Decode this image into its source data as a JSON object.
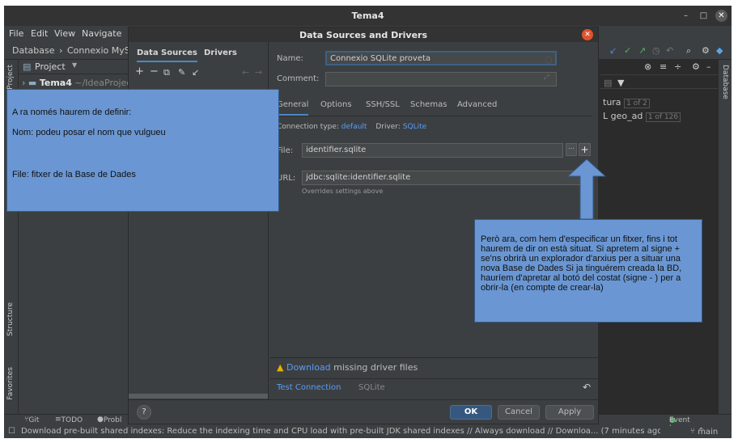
{
  "window": {
    "title": "Tema4"
  },
  "menu": [
    "File",
    "Edit",
    "View",
    "Navigate"
  ],
  "breadcrumb": [
    "Database",
    "Connexio MySQL"
  ],
  "project": {
    "header": "Project",
    "root_name": "Tema4",
    "root_path": "~/IdeaProject"
  },
  "left_strip": {
    "project": "Project",
    "structure": "Structure",
    "favorites": "Favorites"
  },
  "right_strip": {
    "database": "Database"
  },
  "db_panel": {
    "row1_name": "tura",
    "row1_badge": "1 of 2",
    "row2_name": "L geo_ad",
    "row2_badge": "1 of 126"
  },
  "dialog": {
    "title": "Data Sources and Drivers",
    "left_tabs": [
      "Data Sources",
      "Drivers"
    ],
    "name_label": "Name:",
    "name_value": "Connexio SQLite proveta",
    "comment_label": "Comment:",
    "tabs": [
      "General",
      "Options",
      "SSH/SSL",
      "Schemas",
      "Advanced"
    ],
    "connection_type_label": "Connection type:",
    "connection_type_value": "default",
    "driver_label": "Driver:",
    "driver_value": "SQLite",
    "file_label": "File:",
    "file_value": "identifier.sqlite",
    "url_label": "URL:",
    "url_value": "jdbc:sqlite:identifier.sqlite",
    "url_hint": "Overrides settings above",
    "warning_link": "Download",
    "warning_text": "missing driver files",
    "test_connection": "Test Connection",
    "test_driver": "SQLite",
    "ok": "OK",
    "cancel": "Cancel",
    "apply": "Apply",
    "help": "?"
  },
  "bottom_tabs": [
    "Git",
    "TODO",
    "Probl"
  ],
  "event_log": "Event Log",
  "branch": "main",
  "status_message": "Download pre-built shared indexes: Reduce the indexing time and CPU load with pre-built JDK shared indexes // Always download // Downloa... (7 minutes ago)",
  "callout1": {
    "line1": "A ra només haurem de definir:",
    "line2": "Nom: podeu posar el nom que vulgueu",
    "line3": "File: fitxer de la Base de Dades"
  },
  "callout2": {
    "text": "Però ara, com hem d'especificar un fitxer, fins i tot haurem de dir on està situat. Si apretem al signe + se'ns obrirà un explorador d'arxius per a situar una nova Base de Dades Si ja tinguérem creada la BD, hauríem d'apretar al botó del costat (signe - ) per a obrir-la (en compte de crear-la)"
  },
  "colors": {
    "accent": "#4a88c7",
    "link": "#589df6",
    "callout": "#6a97d3",
    "close": "#e0532c"
  }
}
